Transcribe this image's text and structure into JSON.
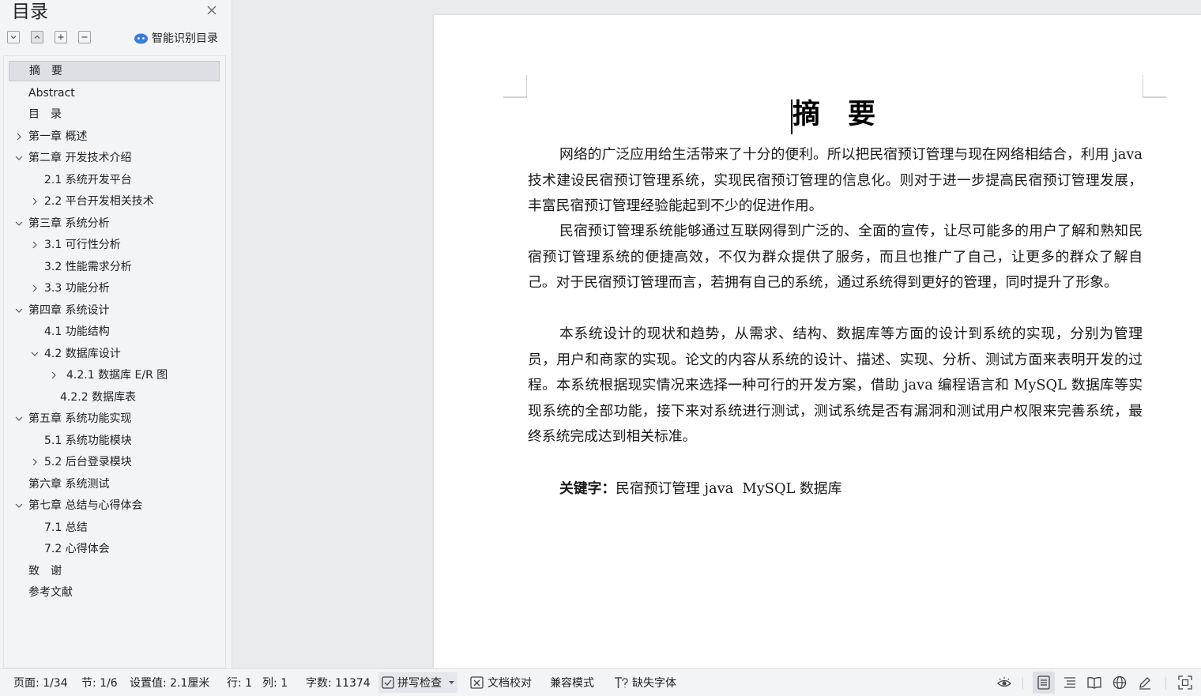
{
  "sidebar": {
    "title": "目录",
    "smart_toc_label": "智能识别目录",
    "toc": [
      {
        "label": "摘　要",
        "level": 1,
        "expander": "none",
        "selected": true
      },
      {
        "label": "Abstract",
        "level": 1,
        "expander": "none"
      },
      {
        "label": "目　录",
        "level": 1,
        "expander": "none"
      },
      {
        "label": "第一章  概述",
        "level": 1,
        "expander": "collapsed"
      },
      {
        "label": "第二章  开发技术介绍",
        "level": 1,
        "expander": "expanded"
      },
      {
        "label": "2.1  系统开发平台",
        "level": 2,
        "expander": "none"
      },
      {
        "label": "2.2  平台开发相关技术",
        "level": 2,
        "expander": "collapsed"
      },
      {
        "label": "第三章  系统分析",
        "level": 1,
        "expander": "expanded"
      },
      {
        "label": "3.1  可行性分析",
        "level": 2,
        "expander": "collapsed"
      },
      {
        "label": "3.2 性能需求分析",
        "level": 2,
        "expander": "none"
      },
      {
        "label": "3.3 功能分析",
        "level": 2,
        "expander": "collapsed"
      },
      {
        "label": "第四章  系统设计",
        "level": 1,
        "expander": "expanded"
      },
      {
        "label": "4.1 功能结构",
        "level": 2,
        "expander": "none"
      },
      {
        "label": "4.2  数据库设计",
        "level": 2,
        "expander": "expanded"
      },
      {
        "label": "4.2.1  数据库 E/R 图",
        "level": 3,
        "expander": "collapsed"
      },
      {
        "label": "4.2.2  数据库表",
        "level": 3,
        "expander": "none"
      },
      {
        "label": "第五章  系统功能实现",
        "level": 1,
        "expander": "expanded"
      },
      {
        "label": "5.1 系统功能模块",
        "level": 2,
        "expander": "none"
      },
      {
        "label": "5.2 后台登录模块",
        "level": 2,
        "expander": "collapsed"
      },
      {
        "label": "第六章  系统测试",
        "level": 1,
        "expander": "none"
      },
      {
        "label": "第七章  总结与心得体会",
        "level": 1,
        "expander": "expanded"
      },
      {
        "label": "7.1  总结",
        "level": 2,
        "expander": "none"
      },
      {
        "label": "7.2  心得体会",
        "level": 2,
        "expander": "none"
      },
      {
        "label": "致　谢",
        "level": 1,
        "expander": "none"
      },
      {
        "label": "参考文献",
        "level": 1,
        "expander": "none"
      }
    ]
  },
  "document": {
    "title": "摘　要",
    "paragraphs": [
      "网络的广泛应用给生活带来了十分的便利。所以把民宿预订管理与现在网络相结合，利用 java 技术建设民宿预订管理系统，实现民宿预订管理的信息化。则对于进一步提高民宿预订管理发展，丰富民宿预订管理经验能起到不少的促进作用。",
      "民宿预订管理系统能够通过互联网得到广泛的、全面的宣传，让尽可能多的用户了解和熟知民宿预订管理系统的便捷高效，不仅为群众提供了服务，而且也推广了自己，让更多的群众了解自己。对于民宿预订管理而言，若拥有自己的系统，通过系统得到更好的管理，同时提升了形象。",
      "本系统设计的现状和趋势，从需求、结构、数据库等方面的设计到系统的实现，分别为管理员，用户和商家的实现。论文的内容从系统的设计、描述、实现、分析、测试方面来表明开发的过程。本系统根据现实情况来选择一种可行的开发方案，借助 java 编程语言和 MySQL 数据库等实现系统的全部功能，接下来对系统进行测试，测试系统是否有漏洞和测试用户权限来完善系统，最终系统完成达到相关标准。"
    ],
    "keywords_label": "关键字：",
    "keywords_value": "民宿预订管理 java  MySQL 数据库"
  },
  "statusbar": {
    "page": "页面: 1/34",
    "section": "节: 1/6",
    "setting": "设置值: 2.1厘米",
    "row": "行: 1",
    "col": "列: 1",
    "word_count": "字数: 11374",
    "spell_check": "拼写检查",
    "proofread": "文档校对",
    "compat_mode": "兼容模式",
    "missing_fonts": "缺失字体"
  },
  "colors": {
    "selection_bg": "#dcdfe4",
    "accent": "#3a7be0"
  }
}
